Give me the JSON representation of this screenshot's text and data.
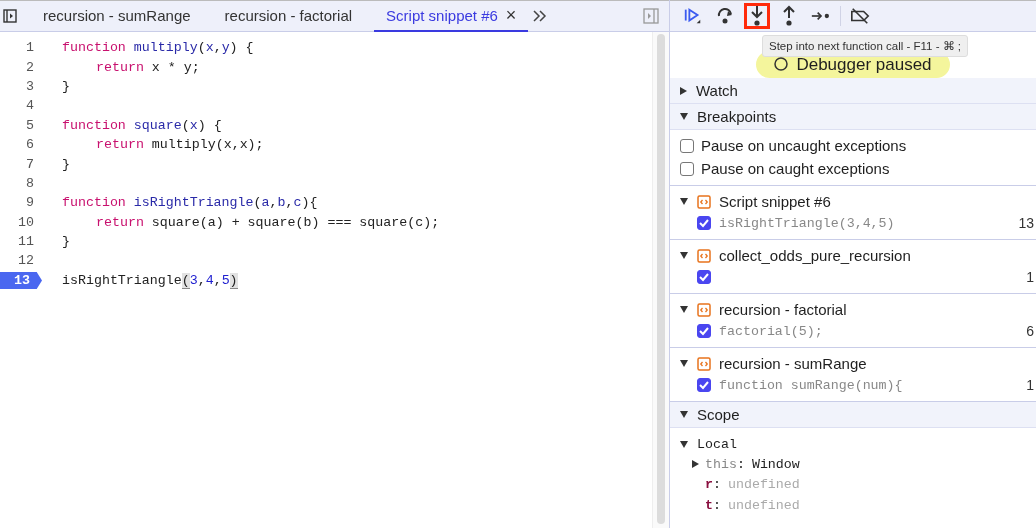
{
  "editor_tabs": [
    {
      "label": "recursion - sumRange",
      "selected": false
    },
    {
      "label": "recursion - factorial",
      "selected": false
    },
    {
      "label": "Script snippet #6",
      "selected": true,
      "close": "×"
    }
  ],
  "code_lines": [
    {
      "number": "1",
      "breakpoint": false,
      "tokens": [
        {
          "kind": "keyword",
          "text": "function"
        },
        {
          "kind": "name",
          "text": " multiply"
        },
        {
          "kind": "plain",
          "text": "("
        },
        {
          "kind": "name",
          "text": "x"
        },
        {
          "kind": "plain",
          "text": ","
        },
        {
          "kind": "name",
          "text": "y"
        },
        {
          "kind": "plain",
          "text": ") {"
        }
      ]
    },
    {
      "number": "2",
      "breakpoint": false,
      "indent": true,
      "tokens": [
        {
          "kind": "keyword",
          "text": "return"
        },
        {
          "kind": "plain",
          "text": " x * y;"
        }
      ]
    },
    {
      "number": "3",
      "breakpoint": false,
      "tokens": [
        {
          "kind": "plain",
          "text": "}"
        }
      ]
    },
    {
      "number": "4",
      "breakpoint": false
    },
    {
      "number": "5",
      "breakpoint": false,
      "tokens": [
        {
          "kind": "keyword",
          "text": "function"
        },
        {
          "kind": "name",
          "text": " square"
        },
        {
          "kind": "plain",
          "text": "("
        },
        {
          "kind": "name",
          "text": "x"
        },
        {
          "kind": "plain",
          "text": ") {"
        }
      ]
    },
    {
      "number": "6",
      "breakpoint": false,
      "indent": true,
      "tokens": [
        {
          "kind": "keyword",
          "text": "return"
        },
        {
          "kind": "plain",
          "text": " multiply(x,x);"
        }
      ]
    },
    {
      "number": "7",
      "breakpoint": false,
      "tokens": [
        {
          "kind": "plain",
          "text": "}"
        }
      ]
    },
    {
      "number": "8",
      "breakpoint": false
    },
    {
      "number": "9",
      "breakpoint": false,
      "tokens": [
        {
          "kind": "keyword",
          "text": "function"
        },
        {
          "kind": "name",
          "text": " isRightTriangle"
        },
        {
          "kind": "plain",
          "text": "("
        },
        {
          "kind": "name",
          "text": "a"
        },
        {
          "kind": "plain",
          "text": ","
        },
        {
          "kind": "name",
          "text": "b"
        },
        {
          "kind": "plain",
          "text": ","
        },
        {
          "kind": "name",
          "text": "c"
        },
        {
          "kind": "plain",
          "text": "){"
        }
      ]
    },
    {
      "number": "10",
      "breakpoint": false,
      "indent": true,
      "tokens": [
        {
          "kind": "keyword",
          "text": "return"
        },
        {
          "kind": "plain",
          "text": " square(a) + square(b) === square(c);"
        }
      ]
    },
    {
      "number": "11",
      "breakpoint": false,
      "tokens": [
        {
          "kind": "plain",
          "text": "}"
        }
      ]
    },
    {
      "number": "12",
      "breakpoint": false
    },
    {
      "number": "13",
      "breakpoint": true,
      "tokens": [
        {
          "kind": "plain",
          "text": "isRightTriangle"
        },
        {
          "kind": "match",
          "text": "("
        },
        {
          "kind": "number",
          "text": "3"
        },
        {
          "kind": "plain",
          "text": ","
        },
        {
          "kind": "number",
          "text": "4"
        },
        {
          "kind": "plain",
          "text": ","
        },
        {
          "kind": "number",
          "text": "5"
        },
        {
          "kind": "match",
          "text": ")"
        }
      ]
    }
  ],
  "debug_toolbar": [
    {
      "kind": "resume",
      "highlighted": false
    },
    {
      "kind": "step-over",
      "highlighted": false
    },
    {
      "kind": "step-into",
      "highlighted": true
    },
    {
      "kind": "step-out",
      "highlighted": false
    },
    {
      "kind": "step",
      "highlighted": false
    },
    {
      "kind": "deactivate",
      "highlighted": false
    }
  ],
  "tooltip": "Step into next function call - F11 - ⌘ ;",
  "paused_banner": "Debugger paused",
  "watch": {
    "label": "Watch",
    "expanded": false
  },
  "breakpoints": {
    "label": "Breakpoints",
    "expanded": true,
    "options": [
      {
        "label": "Pause on uncaught exceptions",
        "checked": false
      },
      {
        "label": "Pause on caught exceptions",
        "checked": false
      }
    ],
    "files": [
      {
        "name": "Script snippet #6",
        "expanded": true,
        "items": [
          {
            "code": "isRightTriangle(3,4,5)",
            "line": "13",
            "checked": true
          }
        ]
      },
      {
        "name": "collect_odds_pure_recursion",
        "expanded": true,
        "items": [
          {
            "line": "1",
            "checked": true
          }
        ]
      },
      {
        "name": "recursion - factorial",
        "expanded": true,
        "items": [
          {
            "code": "factorial(5);",
            "line": "6",
            "checked": true
          }
        ]
      },
      {
        "name": "recursion - sumRange",
        "expanded": true,
        "items": [
          {
            "code": "function sumRange(num){",
            "line": "1",
            "checked": true
          }
        ]
      }
    ]
  },
  "scope": {
    "label": "Scope",
    "expanded": true,
    "groups": [
      {
        "label": "Local",
        "expanded": true,
        "vars": [
          {
            "name": "this",
            "separator": ":",
            "value": "Window",
            "kind": "object",
            "expanded": false
          },
          {
            "name": "r",
            "separator": ":",
            "value": "undefined",
            "kind": "plain"
          },
          {
            "name": "t",
            "separator": ":",
            "value": "undefined",
            "kind": "plain"
          }
        ]
      }
    ]
  }
}
